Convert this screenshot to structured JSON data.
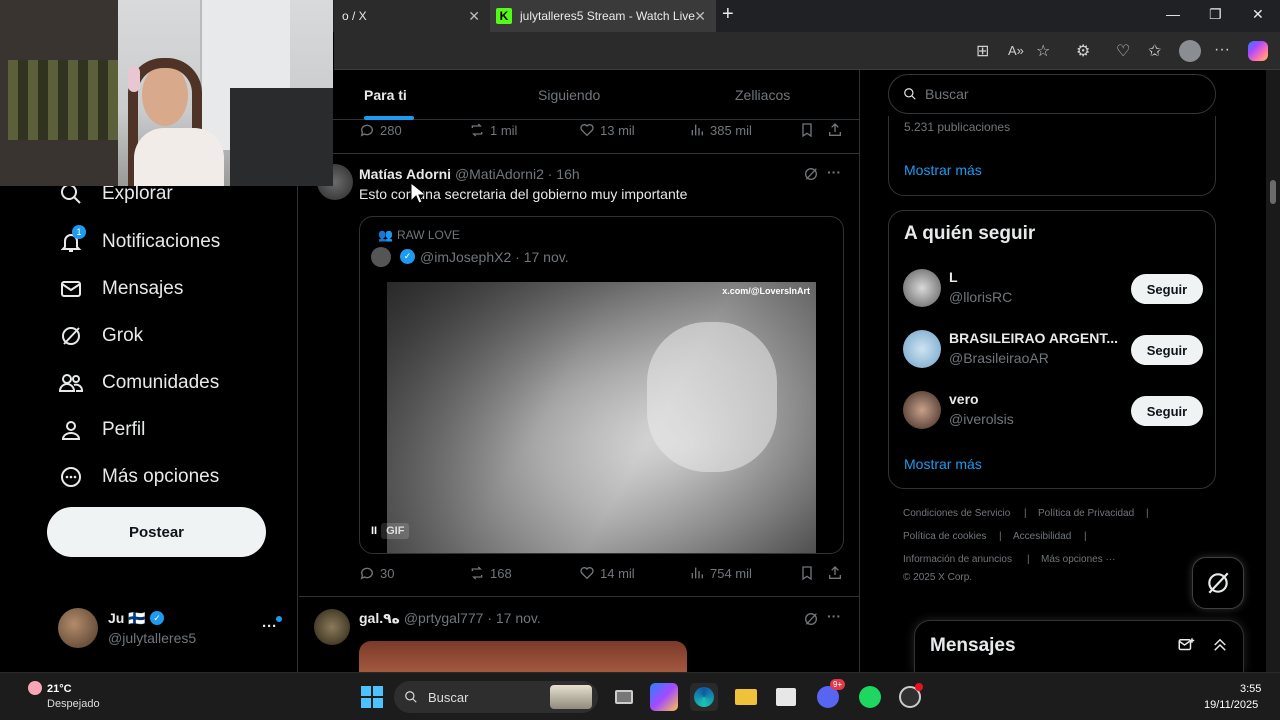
{
  "browser": {
    "tab1_title": "o / X",
    "tab2_title": "julytalleres5 Stream - Watch Live",
    "tab2_favicon": "K",
    "close_glyph": "✕",
    "new_tab_glyph": "+"
  },
  "nav": {
    "items": [
      {
        "label": "Explorar",
        "icon": "search-icon"
      },
      {
        "label": "Notificaciones",
        "icon": "bell-icon",
        "badge": "1"
      },
      {
        "label": "Mensajes",
        "icon": "mail-icon"
      },
      {
        "label": "Grok",
        "icon": "grok-icon"
      },
      {
        "label": "Comunidades",
        "icon": "people-icon"
      },
      {
        "label": "Perfil",
        "icon": "person-icon"
      },
      {
        "label": "Más opciones",
        "icon": "more-circle-icon"
      }
    ],
    "post_label": "Postear",
    "account_name": "Ju 🇫🇮",
    "account_handle": "@julytalleres5",
    "account_more": "···"
  },
  "feed": {
    "tabs": [
      "Para ti",
      "Siguiendo",
      "Zelliacos"
    ],
    "top_actions": {
      "replies": "280",
      "reposts": "1 mil",
      "likes": "13 mil",
      "views": "385 mil"
    },
    "tweet1": {
      "name": "Matías Adorni",
      "handle": "@MatiAdorni2",
      "time": "· 16h",
      "text": "Esto con una secretaria del gobierno muy importante",
      "quote_community": "RAW LOVE",
      "quote_handle": "@imJosephX2",
      "quote_time": "· 17 nov.",
      "media_watermark": "x.com/@LoversInArt",
      "gif_label": "GIF",
      "pause_glyph": "II",
      "actions": {
        "replies": "30",
        "reposts": "168",
        "likes": "14 mil",
        "views": "754 mil"
      }
    },
    "tweet2": {
      "name": "gal.ه٩",
      "handle": "@prtygal777",
      "time": "· 17 nov."
    },
    "more_glyph": "···"
  },
  "right": {
    "search_placeholder": "Buscar",
    "trend_count": "5.231 publicaciones",
    "show_more": "Mostrar más",
    "who_to_follow_title": "A quién seguir",
    "follow": [
      {
        "name": "L",
        "handle": "@llorisRC",
        "button": "Seguir"
      },
      {
        "name": "BRASILEIRAO ARGENT...",
        "handle": "@BrasileiraoAR",
        "button": "Seguir"
      },
      {
        "name": "vero",
        "handle": "@iverolsis",
        "button": "Seguir"
      }
    ],
    "footer": {
      "terms": "Condiciones de Servicio",
      "privacy": "Política de Privacidad",
      "cookies": "Política de cookies",
      "accessibility": "Accesibilidad",
      "ads": "Información de anuncios",
      "more": "Más opciones ···",
      "copyright": "© 2025 X Corp.",
      "divider": "|"
    },
    "messages_title": "Mensajes"
  },
  "taskbar": {
    "weather_temp": "21°C",
    "weather_desc": "Despejado",
    "search_label": "Buscar",
    "time": "3:55",
    "date": "19/11/2025",
    "discord_badge": "9+"
  },
  "colors": {
    "accent": "#1d9bf0",
    "bg": "#000000",
    "text": "#e7e9ea",
    "muted": "#71767b",
    "kick": "#53fc18"
  }
}
